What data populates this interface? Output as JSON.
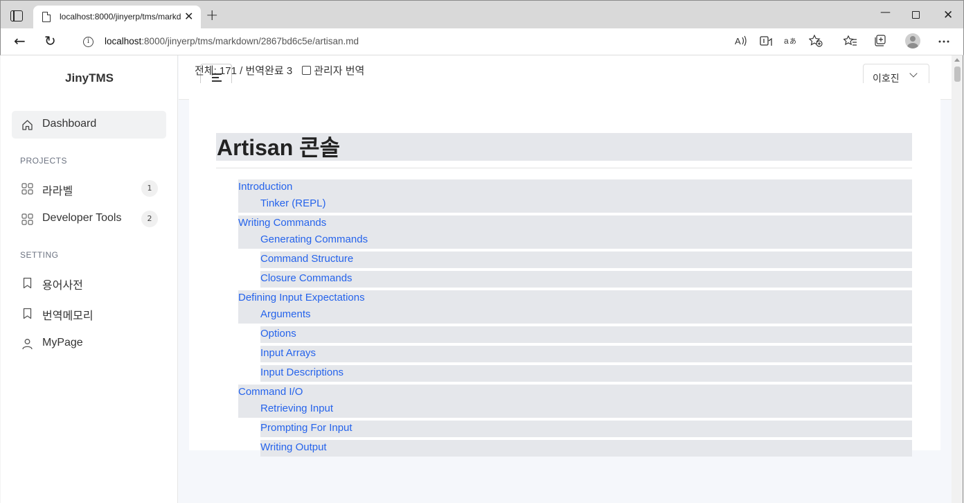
{
  "browser": {
    "tab_title": "localhost:8000/jinyerp/tms/markdown/2867bd6c5e/artisan.md",
    "close_glyph": "✕",
    "new_tab_glyph": "+",
    "url_host": "localhost",
    "url_rest": ":8000/jinyerp/tms/markdown/2867bd6c5e/artisan.md",
    "back_glyph": "←",
    "reload_glyph": "↻",
    "minimize_glyph": "—",
    "window_close_glyph": "✕"
  },
  "sidebar": {
    "brand": "JinyTMS",
    "dashboard": "Dashboard",
    "projects_header": "PROJECTS",
    "projects": [
      {
        "label": "라라벨",
        "count": "1"
      },
      {
        "label": "Developer Tools",
        "count": "2"
      }
    ],
    "setting_header": "SETTING",
    "settings": [
      {
        "label": "용어사전"
      },
      {
        "label": "번역메모리"
      },
      {
        "label": "MyPage"
      }
    ]
  },
  "topnav": {
    "user_name": "이호진"
  },
  "stats": {
    "text": "전체: 171 / 번역완료 3",
    "admin_label": "관리자 번역"
  },
  "document": {
    "title": "Artisan 콘솔",
    "toc": [
      {
        "label": "Introduction",
        "children": [
          "Tinker (REPL)"
        ]
      },
      {
        "label": "Writing Commands",
        "children": [
          "Generating Commands",
          "Command Structure",
          "Closure Commands"
        ]
      },
      {
        "label": "Defining Input Expectations",
        "children": [
          "Arguments",
          "Options",
          "Input Arrays",
          "Input Descriptions"
        ]
      },
      {
        "label": "Command I/O",
        "children": [
          "Retrieving Input",
          "Prompting For Input",
          "Writing Output"
        ]
      }
    ]
  },
  "colors": {
    "link": "#2563eb",
    "highlight": "#e5e7eb"
  }
}
